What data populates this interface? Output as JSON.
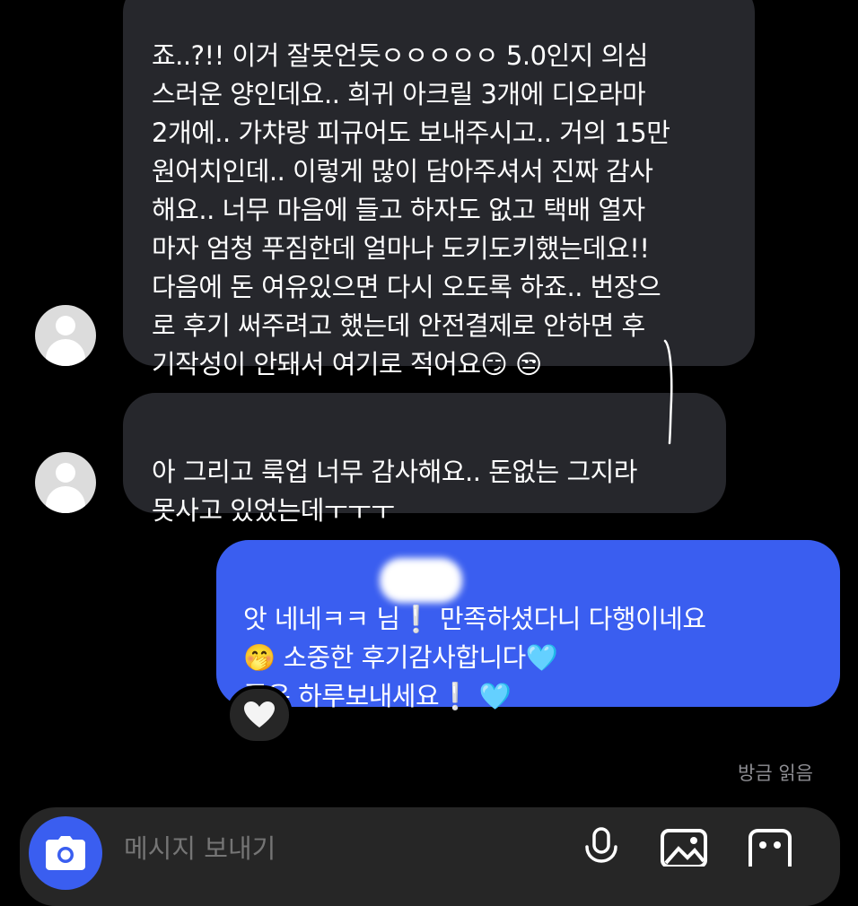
{
  "messages": [
    {
      "direction": "incoming",
      "text": "죠..?!! 이거 잘못언듯ㅇㅇㅇㅇㅇ 5.0인지 의심\n스러운 양인데요.. 희귀 아크릴 3개에 디오라마\n2개에.. 가챠랑 피규어도 보내주시고.. 거의 15만\n원어치인데.. 이렇게 많이 담아주셔서 진짜 감사\n해요.. 너무 마음에 들고 하자도 없고 택배 열자\n마자 엄청 푸짐한데 얼마나 도키도키했는데요!!\n다음에 돈 여유있으면 다시 오도록 하죠.. 번장으\n로 후기 써주려고 했는데 안전결제로 안하면 후\n기작성이 안돼서 여기로 적어요😏 😒"
    },
    {
      "direction": "incoming",
      "text": "아 그리고 룩업 너무 감사해요.. 돈없는 그지라\n못사고 있었는데ㅜㅜㅜ"
    },
    {
      "direction": "outgoing",
      "text": "앗 네네ㅋㅋ     님❕ 만족하셨다니 다행이네요\n🤭 소중한 후기감사합니다🩵\n좋은 하루보내세요❕ 🩵"
    }
  ],
  "reaction": {
    "icon": "white-heart-icon",
    "glyph": "🤍"
  },
  "read_status": "방금 읽음",
  "composer": {
    "placeholder": "메시지 보내기",
    "icons": [
      "camera-icon",
      "microphone-icon",
      "gallery-icon",
      "sticker-icon"
    ]
  },
  "colors": {
    "background": "#000000",
    "incoming_bubble": "#26272c",
    "outgoing_bubble": "#3a5ef0",
    "muted_text": "#8e8e93"
  }
}
